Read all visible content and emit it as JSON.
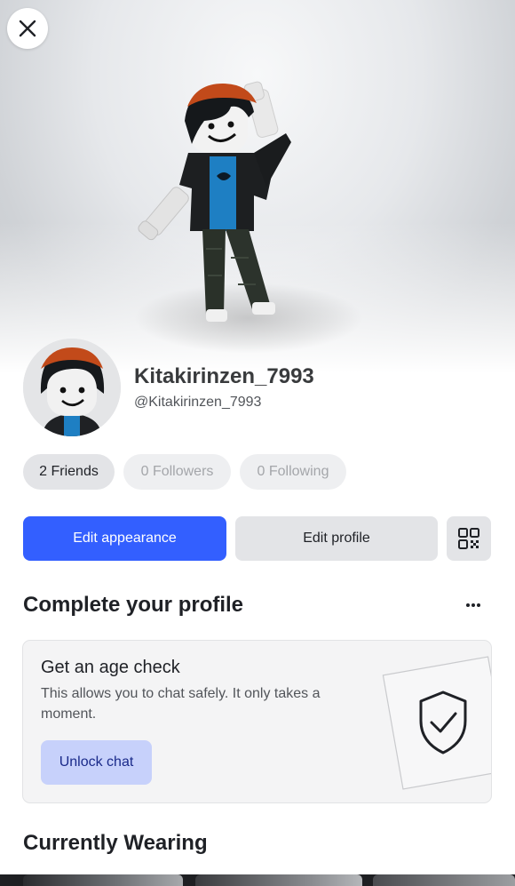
{
  "profile": {
    "display_name": "Kitakirinzen_7993",
    "username": "@Kitakirinzen_7993"
  },
  "stats": {
    "friends": "2 Friends",
    "followers": "0 Followers",
    "following": "0 Following"
  },
  "actions": {
    "edit_appearance": "Edit appearance",
    "edit_profile": "Edit profile",
    "qr_icon": "qr-code-icon"
  },
  "complete_profile": {
    "title": "Complete your profile",
    "more_icon": "more-horizontal-icon",
    "card": {
      "title": "Get an age check",
      "description": "This allows you to chat safely. It only takes a moment.",
      "button": "Unlock chat",
      "icon": "shield-check-icon"
    }
  },
  "currently_wearing": {
    "title": "Currently Wearing"
  },
  "colors": {
    "accent": "#335fff",
    "accent_soft": "#c7d1fb",
    "pill_bg": "#e3e4e7",
    "text_primary": "#1f2126",
    "text_muted": "#a4a6aa"
  }
}
